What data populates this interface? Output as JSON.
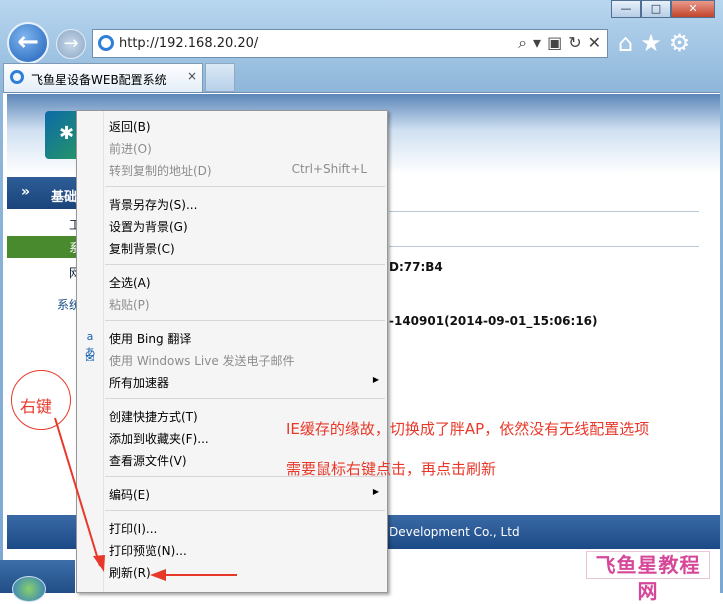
{
  "browser": {
    "url": "http://192.168.20.20/",
    "tab_title": "飞鱼星设备WEB配置系统",
    "tab_close": "×",
    "window_buttons": [
      "—",
      "□",
      "✕"
    ],
    "back_icon": "←",
    "forward_icon": "→",
    "right_icons": [
      "⌂",
      "★",
      "⚙"
    ],
    "address_icons": [
      "⌕",
      "▾",
      "▣",
      "↻",
      "✕"
    ]
  },
  "page": {
    "sidebar_header": "基础",
    "sidebar_chevron": "»",
    "sidebar_items": [
      "工",
      "系",
      "网"
    ],
    "sys_link": "系统",
    "info_mac": "D:77:B4",
    "info_version": "-140901(2014-09-01_15:06:16)",
    "footer": "Development Co., Ltd"
  },
  "context_menu": {
    "items": [
      {
        "label": "返回(B)",
        "shortcut": "",
        "disabled": false
      },
      {
        "label": "前进(O)",
        "shortcut": "",
        "disabled": true
      },
      {
        "label": "转到复制的地址(D)",
        "shortcut": "Ctrl+Shift+L",
        "disabled": true
      },
      {
        "label": "背景另存为(S)...",
        "shortcut": "",
        "disabled": false
      },
      {
        "label": "设置为背景(G)",
        "shortcut": "",
        "disabled": false
      },
      {
        "label": "复制背景(C)",
        "shortcut": "",
        "disabled": false
      },
      {
        "label": "全选(A)",
        "shortcut": "",
        "disabled": false
      },
      {
        "label": "粘贴(P)",
        "shortcut": "",
        "disabled": true
      },
      {
        "label": "使用 Bing 翻译",
        "shortcut": "",
        "disabled": false
      },
      {
        "label": "使用 Windows Live 发送电子邮件",
        "shortcut": "",
        "disabled": true
      },
      {
        "label": "所有加速器",
        "shortcut": "",
        "disabled": false
      },
      {
        "label": "创建快捷方式(T)",
        "shortcut": "",
        "disabled": false
      },
      {
        "label": "添加到收藏夹(F)...",
        "shortcut": "",
        "disabled": false
      },
      {
        "label": "查看源文件(V)",
        "shortcut": "",
        "disabled": false
      },
      {
        "label": "编码(E)",
        "shortcut": "",
        "disabled": false
      },
      {
        "label": "打印(I)...",
        "shortcut": "",
        "disabled": false
      },
      {
        "label": "打印预览(N)...",
        "shortcut": "",
        "disabled": false
      },
      {
        "label": "刷新(R)",
        "shortcut": "",
        "disabled": false
      }
    ]
  },
  "annotations": {
    "right_click": "右键",
    "note_line1": "IE缓存的缘故，切换成了胖AP，依然没有无线配置选项",
    "note_line2": "需要鼠标右键点击，再点击刷新",
    "watermark": "飞鱼星教程网",
    "color": "#e8382a"
  }
}
